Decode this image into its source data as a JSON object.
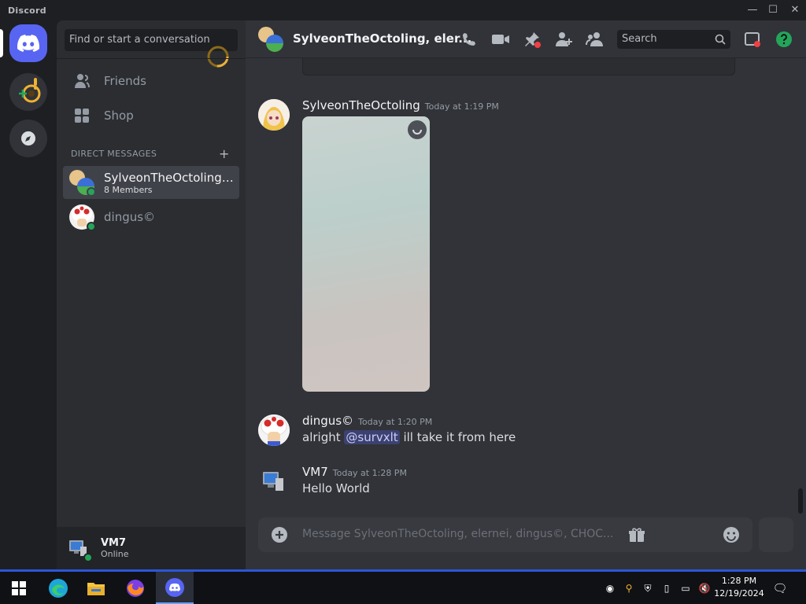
{
  "window": {
    "app_name": "Discord",
    "min": "—",
    "max": "☐",
    "close": "✕"
  },
  "sidebar": {
    "search_placeholder": "Find or start a conversation",
    "nav": [
      {
        "label": "Friends"
      },
      {
        "label": "Shop"
      }
    ],
    "dm_header": "DIRECT MESSAGES",
    "dm_plus": "+",
    "dms": [
      {
        "name": "SylveonTheOctoling, ...",
        "sub": "8 Members"
      },
      {
        "name": "dingus©"
      }
    ],
    "user": {
      "name": "VM7",
      "status": "Online"
    }
  },
  "channel": {
    "title": "SylveonTheOctoling, eler...",
    "search_placeholder": "Search"
  },
  "messages": [
    {
      "author": "SylveonTheOctoling",
      "time": "Today at 1:19 PM"
    },
    {
      "author": "dingus©",
      "time": "Today at 1:20 PM",
      "text_before": "alright ",
      "mention": "@survxlt",
      "text_after": " ill take it from here"
    },
    {
      "author": "VM7",
      "time": "Today at 1:28 PM",
      "text": "Hello World"
    }
  ],
  "composer": {
    "placeholder": "Message SylveonTheOctoling, elernei, dingus©, CHOC..."
  },
  "taskbar": {
    "time": "1:28 PM",
    "date": "12/19/2024"
  },
  "colors": {
    "accent": "#5865f2",
    "online": "#23a55a",
    "bg_main": "#313338",
    "bg_sidebar": "#2b2d31"
  }
}
